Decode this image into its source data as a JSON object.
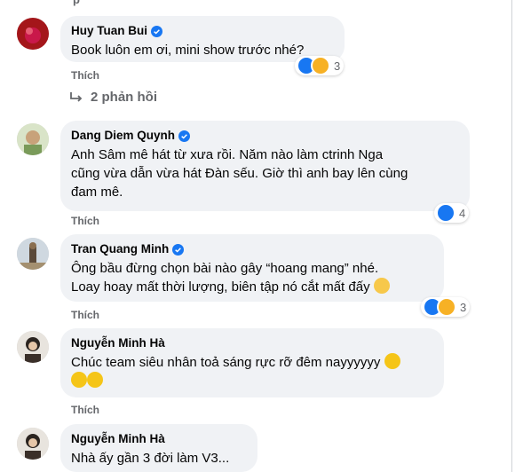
{
  "top_partial_text": "p",
  "comments": [
    {
      "name": "Huy Tuan Bui",
      "verified": true,
      "lines": [
        "Book luôn em ơi, mini show trước nhé?"
      ],
      "action": "Thích",
      "reaction_count": "3",
      "reactions": [
        "like-icon",
        "haha-icon"
      ]
    },
    {
      "name": "Dang Diem Quynh",
      "verified": true,
      "lines": [
        "Anh Sâm mê hát từ xưa rồi. Năm nào làm ctrinh Nga",
        "cũng vừa dẫn vừa hát Đàn sếu. Giờ thì anh bay lên cùng",
        "đam mê."
      ],
      "action": "Thích",
      "reaction_count": "4",
      "reactions": [
        "like-icon"
      ]
    },
    {
      "name": "Tran Quang Minh",
      "verified": true,
      "lines": [
        "Ông bầu đừng chọn bài nào gây “hoang mang” nhé.",
        "Loay hoay mất thời lượng, biên tập nó cắt mất đấy"
      ],
      "action": "Thích",
      "reaction_count": "3",
      "reactions": [
        "like-icon",
        "haha-icon"
      ]
    },
    {
      "name": "Nguyễn Minh Hà",
      "verified": false,
      "lines": [
        "Chúc team siêu nhân toả sáng rực rỡ đêm nayyyyyy"
      ],
      "action": "Thích"
    },
    {
      "name": "Nguyễn Minh Hà",
      "verified": false,
      "lines": [
        "Nhà ấy gần 3 đời làm V3..."
      ]
    }
  ],
  "replies_link": "2 phản hồi",
  "colors": {
    "bubble": "#f0f2f5",
    "link_gray": "#65676b",
    "like_blue": "#1877f2",
    "haha_yellow": "#f7b125"
  }
}
